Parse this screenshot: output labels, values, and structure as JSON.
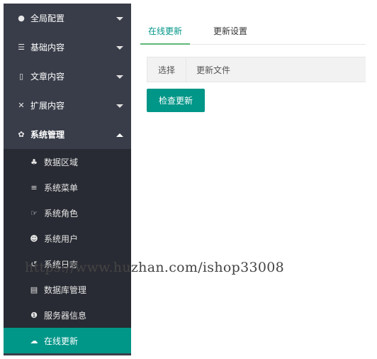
{
  "sidebar": {
    "groups": [
      {
        "label": "全局配置",
        "icon": "settings-circle-icon"
      },
      {
        "label": "基础内容",
        "icon": "sliders-icon"
      },
      {
        "label": "文章内容",
        "icon": "document-icon"
      },
      {
        "label": "扩展内容",
        "icon": "expand-icon"
      },
      {
        "label": "系统管理",
        "icon": "gear-icon"
      }
    ],
    "subitems": [
      {
        "label": "数据区域",
        "icon": "sitemap-icon"
      },
      {
        "label": "系统菜单",
        "icon": "menu-icon"
      },
      {
        "label": "系统角色",
        "icon": "hand-icon"
      },
      {
        "label": "系统用户",
        "icon": "users-icon"
      },
      {
        "label": "系统日志",
        "icon": "history-icon"
      },
      {
        "label": "数据库管理",
        "icon": "database-icon"
      },
      {
        "label": "服务器信息",
        "icon": "info-icon"
      },
      {
        "label": "在线更新",
        "icon": "cloud-upload-icon"
      }
    ]
  },
  "tabs": [
    {
      "label": "在线更新"
    },
    {
      "label": "更新设置"
    }
  ],
  "table": {
    "headers": [
      "选择",
      "更新文件"
    ]
  },
  "check_button": "检查更新",
  "watermark": "https://www.huzhan.com/ishop33008",
  "colors": {
    "sidebar_bg": "#393d49",
    "submenu_bg": "#282b33",
    "accent": "#009688"
  }
}
